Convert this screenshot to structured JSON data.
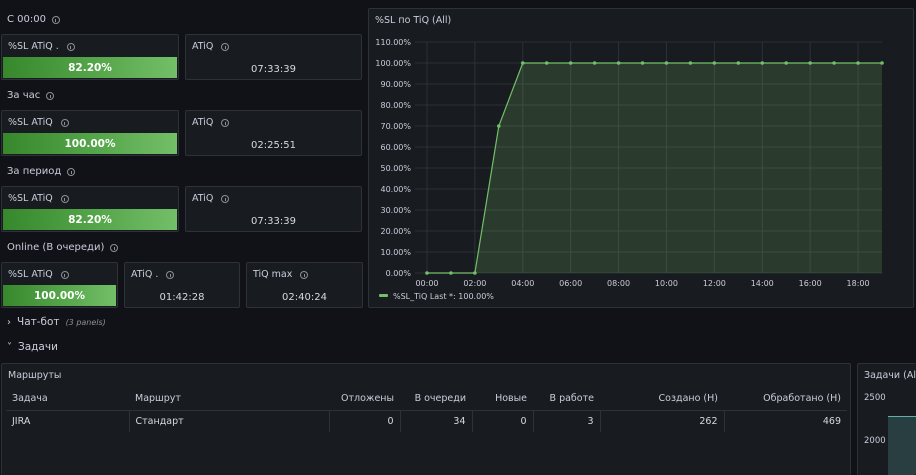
{
  "sections": {
    "since_midnight": "С 00:00",
    "per_hour": "За час",
    "per_period": "За период",
    "online": "Online (В очереди)"
  },
  "stats": {
    "r1": [
      {
        "title": "%SL ATiQ .",
        "value": "82.20%",
        "fill": 1.0
      },
      {
        "title": "ATiQ",
        "value": "07:33:39"
      }
    ],
    "r2": [
      {
        "title": "%SL ATiQ",
        "value": "100.00%",
        "fill": 1.0
      },
      {
        "title": "ATiQ",
        "value": "02:25:51"
      }
    ],
    "r3": [
      {
        "title": "%SL ATiQ",
        "value": "82.20%",
        "fill": 1.0
      },
      {
        "title": "ATiQ",
        "value": "07:33:39"
      }
    ],
    "r4": [
      {
        "title": "%SL ATiQ",
        "value": "100.00%",
        "fill": 1.0
      },
      {
        "title": "ATiQ .",
        "value": "01:42:28"
      },
      {
        "title": "TiQ max",
        "value": "02:40:24"
      }
    ]
  },
  "chart_panel": {
    "title": "%SL по TiQ (All)"
  },
  "chart_data": {
    "type": "area",
    "title": "%SL по TiQ (All)",
    "x_ticks": [
      "00:00",
      "02:00",
      "04:00",
      "06:00",
      "08:00",
      "10:00",
      "12:00",
      "14:00",
      "16:00",
      "18:00"
    ],
    "y_ticks": [
      "0.00%",
      "10.00%",
      "20.00%",
      "30.00%",
      "40.00%",
      "50.00%",
      "60.00%",
      "70.00%",
      "80.00%",
      "90.00%",
      "100.00%",
      "110.00%"
    ],
    "ylim": [
      0,
      110
    ],
    "xlim_hours": [
      -0.5,
      19
    ],
    "series": [
      {
        "name": "%SL_TiQ",
        "color": "#73bf69",
        "x_hours": [
          0,
          1,
          2,
          3,
          4,
          5,
          6,
          7,
          8,
          9,
          10,
          11,
          12,
          13,
          14,
          15,
          16,
          17,
          18,
          19
        ],
        "values": [
          0,
          0,
          0,
          70,
          100,
          100,
          100,
          100,
          100,
          100,
          100,
          100,
          100,
          100,
          100,
          100,
          100,
          100,
          100,
          100
        ]
      }
    ],
    "legend_text": "%SL_TiQ  Last *: 100.00%",
    "legend_placement": "bottom-left",
    "grid": true
  },
  "rows": {
    "chatbot": {
      "label": "Чат-бот",
      "sub": "(3 panels)"
    },
    "tasks": {
      "label": "Задачи"
    }
  },
  "routes_panel": {
    "title": "Маршруты",
    "headers": [
      "Задача",
      "Маршрут",
      "Отложены",
      "В очереди",
      "Новые",
      "В работе",
      "Создано (H)",
      "Обработано (H)"
    ],
    "rows": [
      [
        "JIRA",
        "Стандарт",
        "0",
        "34",
        "0",
        "3",
        "262",
        "469"
      ]
    ]
  },
  "tasks_panel": {
    "title": "Задачи (All)",
    "y_ticks": [
      "2500",
      "2000"
    ]
  },
  "colors": {
    "green": "#73bf69",
    "panel_bg": "#181b1f",
    "page_bg": "#111217"
  }
}
